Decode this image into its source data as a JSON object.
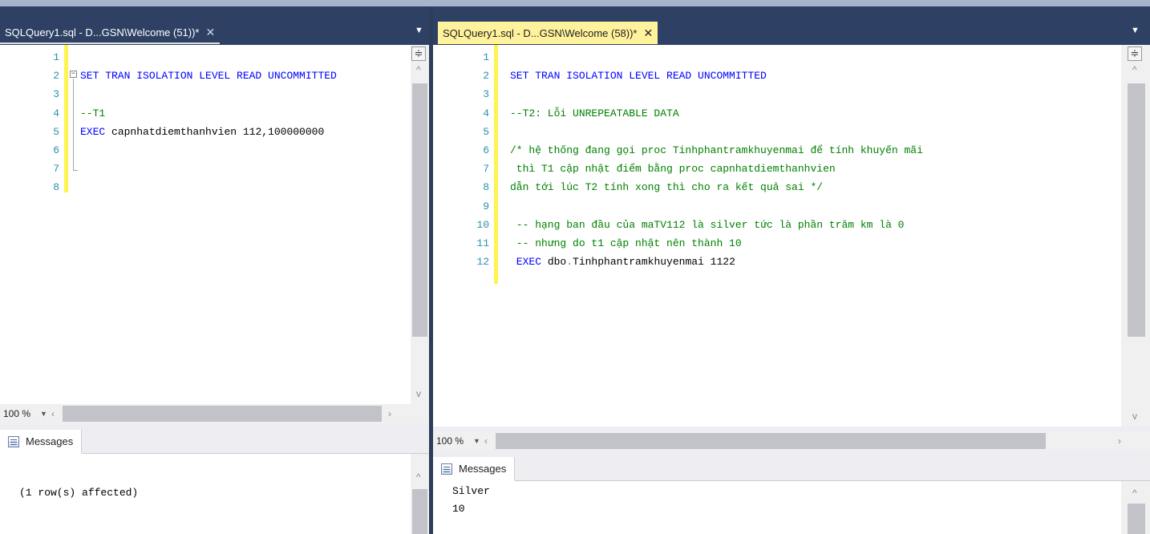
{
  "left_pane": {
    "tab": {
      "title": "SQLQuery1.sql - D...GSN\\Welcome (51))*",
      "close": "✕"
    },
    "tab_strip_dropdown": "▼",
    "editor": {
      "line_numbers": [
        "1",
        "2",
        "3",
        "4",
        "5",
        "6",
        "7",
        "8"
      ],
      "lines": [
        {
          "parts": []
        },
        {
          "parts": [
            {
              "cls": "kw",
              "text": "SET TRAN ISOLATION LEVEL READ UNCOMMITTED"
            }
          ]
        },
        {
          "parts": []
        },
        {
          "parts": [
            {
              "cls": "cm",
              "text": "--T1"
            }
          ]
        },
        {
          "parts": [
            {
              "cls": "kw",
              "text": "EXEC "
            },
            {
              "cls": "id",
              "text": "capnhatdiemthanhvien 112,100000000"
            }
          ]
        },
        {
          "parts": []
        },
        {
          "parts": []
        },
        {
          "parts": []
        }
      ],
      "fold_marker": "−"
    },
    "split_button": "≑",
    "zoom": "100 %",
    "zoom_dropdown": "▼",
    "scroll_left": "‹",
    "scroll_right": "›",
    "scroll_up": "^",
    "scroll_down": "v",
    "output": {
      "tab_label": "Messages",
      "lines": [
        "(1 row(s) affected)"
      ]
    }
  },
  "right_pane": {
    "tab": {
      "title": "SQLQuery1.sql - D...GSN\\Welcome (58))*",
      "close": "✕"
    },
    "tab_strip_dropdown": "▼",
    "editor": {
      "line_numbers": [
        "1",
        "2",
        "3",
        "4",
        "5",
        "6",
        "7",
        "8",
        "9",
        "10",
        "11",
        "12"
      ],
      "lines": [
        {
          "parts": []
        },
        {
          "parts": [
            {
              "cls": "kw",
              "text": "SET TRAN ISOLATION LEVEL READ UNCOMMITTED"
            }
          ]
        },
        {
          "parts": []
        },
        {
          "parts": [
            {
              "cls": "cm",
              "text": "--T2: Lỗi UNREPEATABLE DATA"
            }
          ]
        },
        {
          "parts": []
        },
        {
          "parts": [
            {
              "cls": "cm",
              "text": "/* hệ thống đang gọi proc Tinhphantramkhuyenmai để tính khuyến mãi"
            }
          ]
        },
        {
          "parts": [
            {
              "cls": "cm",
              "text": " thì T1 cập nhật điểm bằng proc capnhatdiemthanhvien"
            }
          ]
        },
        {
          "parts": [
            {
              "cls": "cm",
              "text": "dẫn tới lúc T2 tính xong thì cho ra kết quả sai */"
            }
          ]
        },
        {
          "parts": []
        },
        {
          "parts": [
            {
              "cls": "cm",
              "text": " -- hạng ban đầu của maTV112 là silver tức là phần trăm km là 0"
            }
          ]
        },
        {
          "parts": [
            {
              "cls": "cm",
              "text": " -- nhưng do t1 cập nhật nên thành 10"
            }
          ]
        },
        {
          "parts": [
            {
              "cls": "kw",
              "text": " EXEC "
            },
            {
              "cls": "id",
              "text": "dbo"
            },
            {
              "cls": "dot",
              "text": "."
            },
            {
              "cls": "id",
              "text": "Tinhphantramkhuyenmai 1122"
            }
          ]
        }
      ]
    },
    "split_button": "≑",
    "zoom": "100 %",
    "zoom_dropdown": "▼",
    "scroll_left": "‹",
    "scroll_right": "›",
    "scroll_up": "^",
    "scroll_down": "v",
    "output": {
      "tab_label": "Messages",
      "lines": [
        "Silver",
        "10"
      ]
    }
  },
  "colors": {
    "keyword": "#0000ff",
    "comment": "#008000",
    "line_number": "#2b91af",
    "change_bar": "#fff34d",
    "tab_strip": "#2e4164",
    "active_tab": "#fff29d"
  }
}
